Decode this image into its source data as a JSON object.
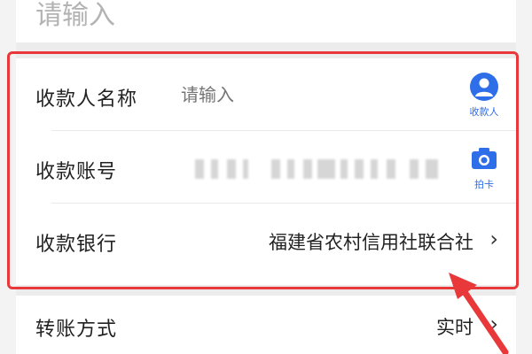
{
  "top": {
    "placeholder": "请输入"
  },
  "form": {
    "rows": [
      {
        "label": "收款人名称",
        "placeholder": "请输入",
        "action_label": "收款人",
        "action_icon": "user-icon"
      },
      {
        "label": "收款账号",
        "value_masked": true,
        "action_label": "拍卡",
        "action_icon": "camera-icon"
      },
      {
        "label": "收款银行",
        "value": "福建省农村信用社联合社",
        "action_icon": "chevron-right-icon"
      }
    ]
  },
  "transfer": {
    "label": "转账方式",
    "value": "实时",
    "action_icon": "chevron-right-icon"
  },
  "colors": {
    "highlight_outline": "#e8383a",
    "accent_blue": "#2f6ee9",
    "text_primary": "#222222",
    "text_placeholder": "#b5b5b5"
  }
}
